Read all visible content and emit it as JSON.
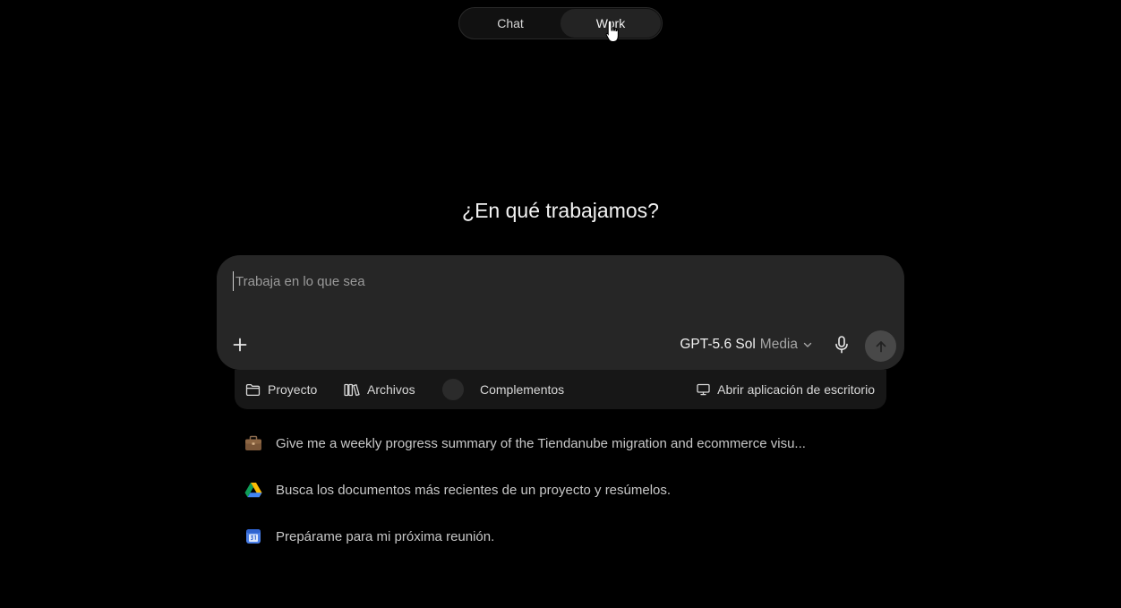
{
  "mode_switch": {
    "tabs": [
      {
        "label": "Chat",
        "active": false
      },
      {
        "label": "Work",
        "active": true
      }
    ]
  },
  "heading": "¿En qué trabajamos?",
  "composer": {
    "placeholder": "Trabaja en lo que sea",
    "value": "",
    "model_name": "GPT-5.6 Sol",
    "model_effort": "Media"
  },
  "tools": {
    "project_label": "Proyecto",
    "files_label": "Archivos",
    "plugins_label": "Complementos",
    "desktop_label": "Abrir aplicación de escritorio"
  },
  "suggestions": [
    {
      "icon": "briefcase-icon",
      "text": "Give me a weekly progress summary of the Tiendanube migration and ecommerce visu..."
    },
    {
      "icon": "google-drive-icon",
      "text": "Busca los documentos más recientes de un proyecto y resúmelos."
    },
    {
      "icon": "calendar-icon",
      "text": "Prepárame para mi próxima reunión."
    }
  ],
  "colors": {
    "background": "#000000",
    "composer_bg": "#262626",
    "tools_bg": "#171717",
    "send_button": "#484848"
  }
}
